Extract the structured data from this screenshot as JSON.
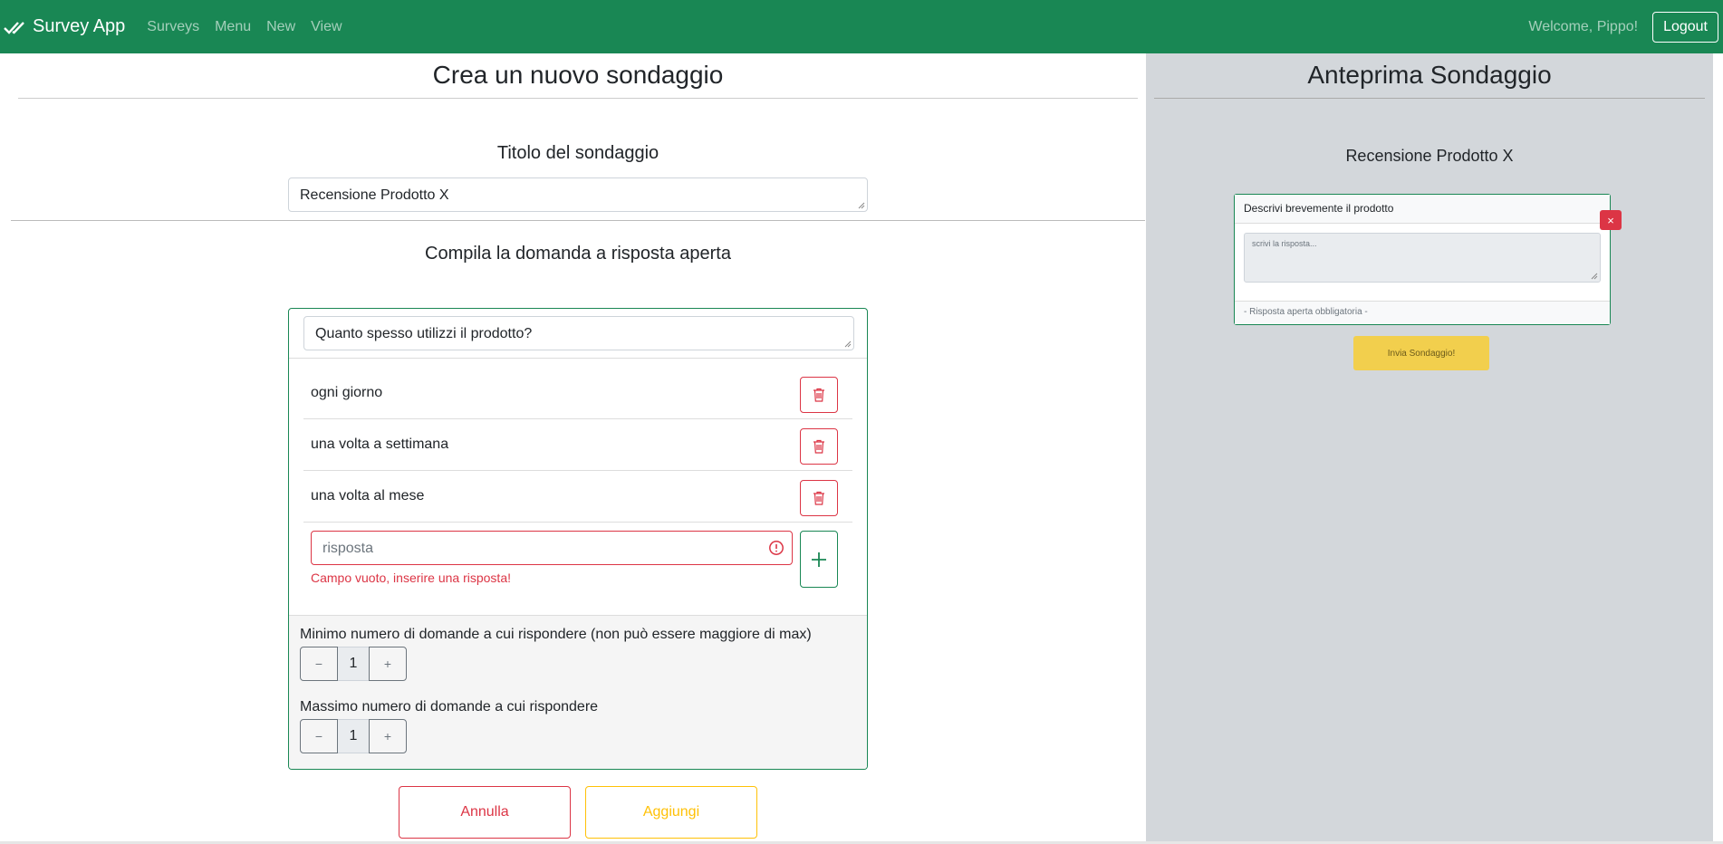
{
  "navbar": {
    "brand": "Survey App",
    "links": [
      "Surveys",
      "Menu",
      "New",
      "View"
    ],
    "welcome": "Welcome, Pippo!",
    "logout": "Logout"
  },
  "editor": {
    "title": "Crea un nuovo sondaggio",
    "survey_title_label": "Titolo del sondaggio",
    "survey_title_value": "Recensione Prodotto X",
    "question_type_label": "Compila la domanda a risposta aperta",
    "question_value": "Quanto spesso utilizzi il prodotto?",
    "answers": [
      "ogni giorno",
      "una volta a settimana",
      "una volta al mese"
    ],
    "new_answer_placeholder": "risposta",
    "error_message": "Campo vuoto, inserire una risposta!",
    "min_label": "Minimo numero di domande a cui rispondere (non può essere maggiore di max)",
    "min_value": "1",
    "max_label": "Massimo numero di domande a cui rispondere",
    "max_value": "1",
    "stepper_minus": "−",
    "stepper_plus": "+",
    "cancel": "Annulla",
    "add": "Aggiungi"
  },
  "preview": {
    "title": "Anteprima Sondaggio",
    "survey_title": "Recensione Prodotto X",
    "question": "Descrivi brevemente il prodotto",
    "answer_placeholder": "scrivi la risposta...",
    "footer": "- Risposta aperta obbligatoria -",
    "close": "×",
    "submit": "Invia Sondaggio!"
  },
  "colors": {
    "primary": "#198754",
    "danger": "#dc3545",
    "warning": "#ffc107"
  }
}
